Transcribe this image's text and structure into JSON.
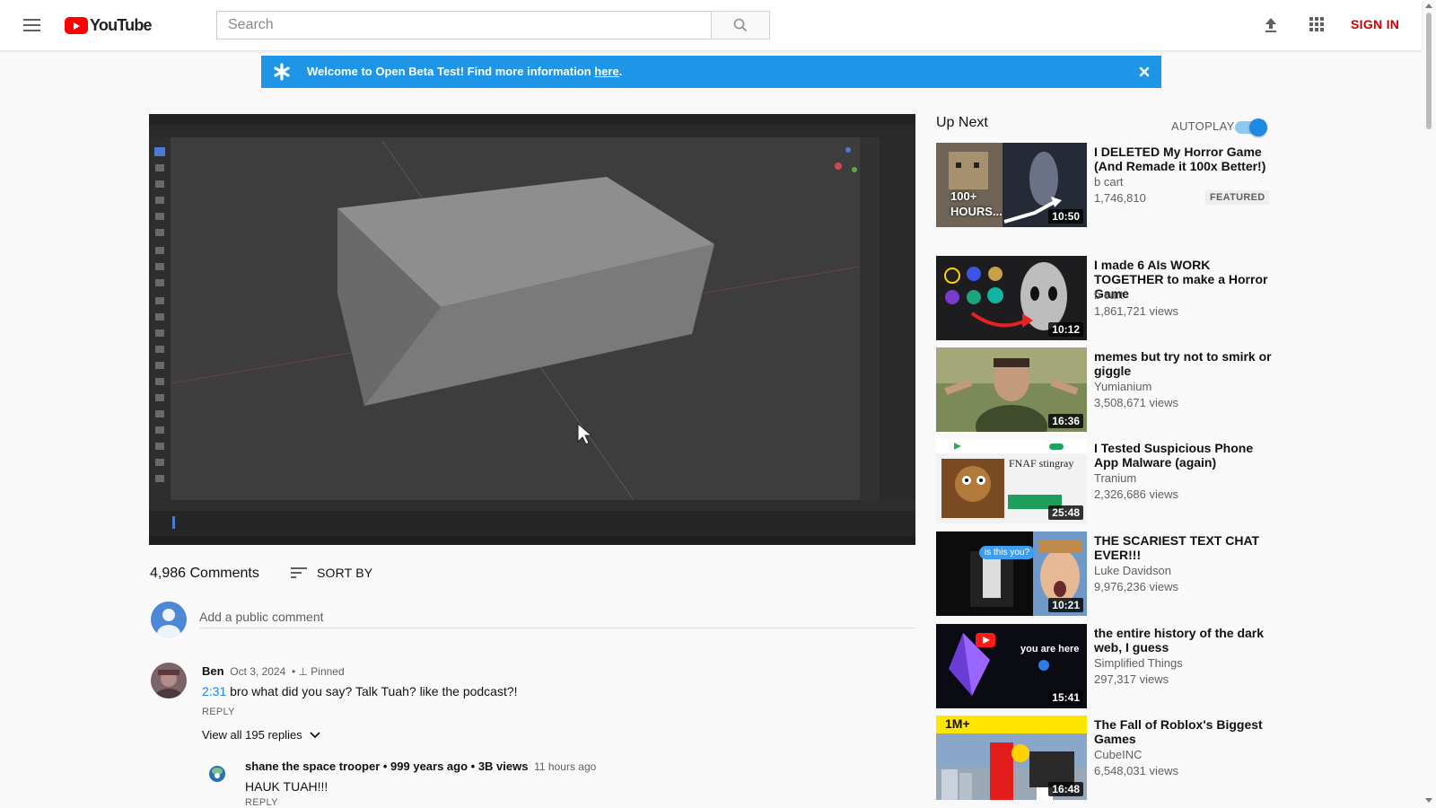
{
  "header": {
    "logo_text": "YouTube",
    "search_placeholder": "Search",
    "sign_in": "SIGN IN"
  },
  "banner": {
    "text": "Welcome to Open Beta Test! Find more information ",
    "link": "here",
    "suffix": "."
  },
  "comments": {
    "count": "4,986 Comments",
    "sort_label": "SORT BY",
    "add_placeholder": "Add a public comment",
    "pinned": {
      "author": "Ben",
      "date": "Oct 3, 2024",
      "pinned_label": "Pinned",
      "timestamp": "2:31",
      "text": " bro what did you say? Talk Tuah? like the podcast?!",
      "reply": "REPLY",
      "view_replies": "View all 195 replies"
    },
    "reply_1": {
      "author": "shane the space trooper • 999 years ago • 3B views",
      "date": "11 hours ago",
      "text": "HAUK TUAH!!!",
      "reply": "REPLY"
    }
  },
  "up_next": {
    "title": "Up Next",
    "autoplay_label": "AUTOPLAY",
    "autoplay_on": true,
    "videos": [
      {
        "title": "I DELETED My Horror Game (And Remade it 100x Better!)",
        "channel": "b cart",
        "views": "1,746,810",
        "duration": "10:50",
        "badge": "FEATURED",
        "thumb_text": "100+ HOURS..."
      },
      {
        "title": "I made 6 AIs WORK TOGETHER to make a Horror Game",
        "channel": "b cart",
        "views": "1,861,721 views",
        "duration": "10:12"
      },
      {
        "title": "memes but try not to smirk or giggle",
        "channel": "Yumianium",
        "views": "3,508,671 views",
        "duration": "16:36"
      },
      {
        "title": "I Tested Suspicious Phone App Malware (again)",
        "channel": "Tranium",
        "views": "2,326,686 views",
        "duration": "25:48",
        "thumb_text": "FNAF stingray"
      },
      {
        "title": "THE SCARIEST TEXT CHAT EVER!!!",
        "channel": "Luke Davidson",
        "views": "9,976,236 views",
        "duration": "10:21",
        "thumb_text": "is this you?"
      },
      {
        "title": "the entire history of the dark web, I guess",
        "channel": "Simplified Things",
        "views": "297,317 views",
        "duration": "15:41",
        "thumb_text": "you are here"
      },
      {
        "title": "The Fall of Roblox's Biggest Games",
        "channel": "CubeINC",
        "views": "6,548,031 views",
        "duration": "16:48",
        "thumb_text": "1M+"
      }
    ]
  }
}
